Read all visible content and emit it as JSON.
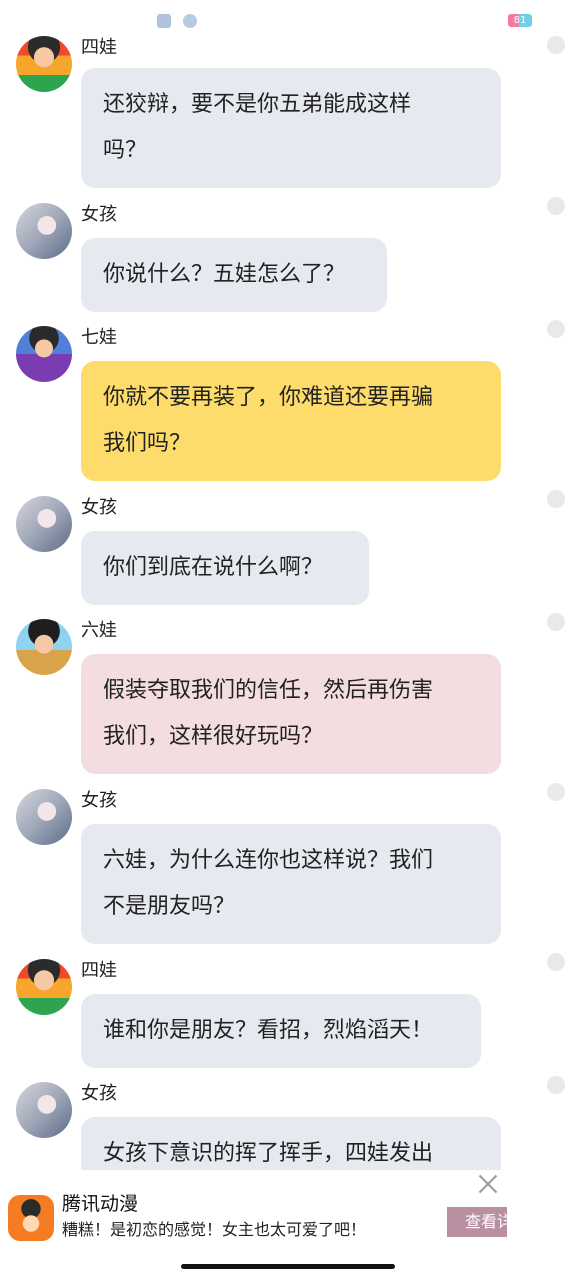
{
  "status_bar": {
    "battery": "81"
  },
  "messages": [
    {
      "sender": "四娃",
      "avatar": "siwa-avatar",
      "color": "gray",
      "lines": [
        "还狡辩，要不是你五弟能成这样",
        "吗？"
      ]
    },
    {
      "sender": "女孩",
      "avatar": "girl-avatar",
      "color": "gray",
      "lines": [
        "你说什么？五娃怎么了？"
      ]
    },
    {
      "sender": "七娃",
      "avatar": "qiwa-avatar",
      "color": "yellow",
      "lines": [
        "你就不要再装了，你难道还要再骗",
        "我们吗？"
      ]
    },
    {
      "sender": "女孩",
      "avatar": "girl-avatar",
      "color": "gray",
      "lines": [
        "你们到底在说什么啊？"
      ]
    },
    {
      "sender": "六娃",
      "avatar": "liuwa-avatar",
      "color": "pink",
      "lines": [
        "假装夺取我们的信任，然后再伤害",
        "我们，这样很好玩吗？"
      ]
    },
    {
      "sender": "女孩",
      "avatar": "girl-avatar",
      "color": "gray",
      "lines": [
        "六娃，为什么连你也这样说？我们",
        "不是朋友吗？"
      ]
    },
    {
      "sender": "四娃",
      "avatar": "siwa-avatar",
      "color": "gray",
      "lines": [
        "谁和你是朋友？看招，烈焰滔天！"
      ]
    },
    {
      "sender": "女孩",
      "avatar": "girl-avatar",
      "color": "gray",
      "lines": [
        "女孩下意识的挥了挥手，四娃发出"
      ]
    }
  ],
  "ad": {
    "title": "腾讯动漫",
    "description": "糟糕！是初恋的感觉！女主也太可爱了吧！",
    "button_label": "查看详情",
    "close_icon": "close-icon"
  },
  "colors": {
    "gray": "#e6e9ef",
    "yellow": "#fddc6b",
    "pink": "#f3dde0"
  }
}
